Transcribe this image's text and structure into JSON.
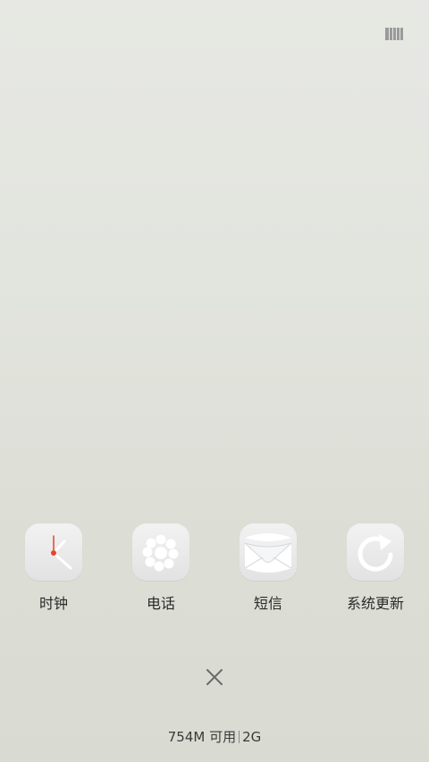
{
  "top_bar": {
    "view_toggle_icon": "grid-view-icon"
  },
  "recent_apps": [
    {
      "label": "时钟",
      "icon": "clock-icon"
    },
    {
      "label": "电话",
      "icon": "phone-icon"
    },
    {
      "label": "短信",
      "icon": "messages-icon"
    },
    {
      "label": "系统更新",
      "icon": "system-update-icon"
    }
  ],
  "clear_button": {
    "icon": "close-icon"
  },
  "memory_status": {
    "available": "754M 可用",
    "total": "2G"
  },
  "colors": {
    "clock_hand": "#e8432c",
    "icon_white": "#ffffff",
    "text": "#2a2a2a"
  }
}
